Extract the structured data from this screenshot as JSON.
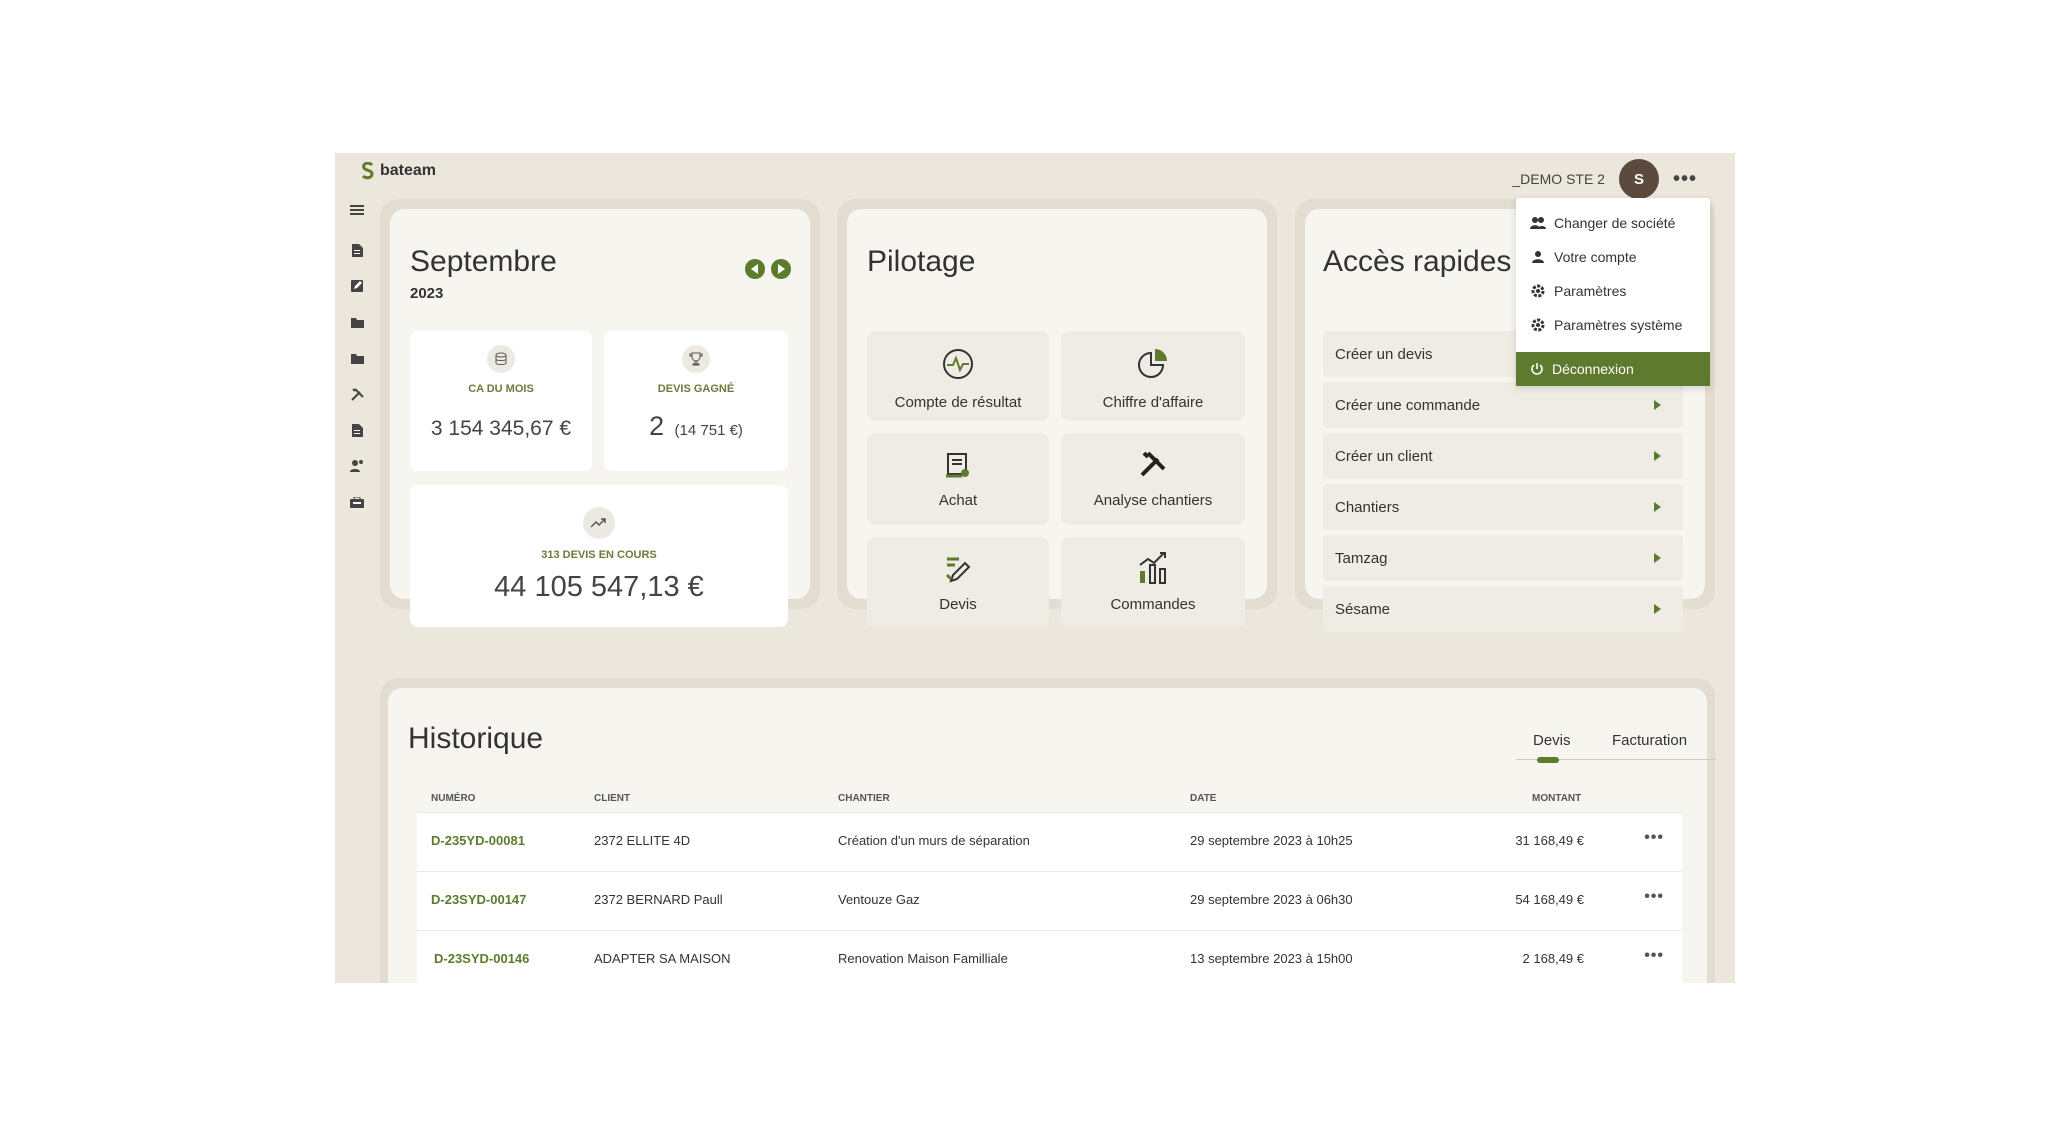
{
  "app": {
    "brand": "bateam",
    "company": "_DEMO STE 2",
    "avatar_initial": "S",
    "accent": "#5e7a2e"
  },
  "menu": {
    "items": [
      {
        "label": "Changer de société",
        "icon": "people-icon"
      },
      {
        "label": "Votre compte",
        "icon": "person-icon"
      },
      {
        "label": "Paramètres",
        "icon": "gear-icon"
      },
      {
        "label": "Paramètres système",
        "icon": "gear-icon"
      }
    ],
    "logout": "Déconnexion"
  },
  "sidebar": {
    "icons": [
      "menu-icon",
      "document-icon",
      "edit-document-icon",
      "folder-icon",
      "folder-icon",
      "tools-icon",
      "document-icon",
      "users-icon",
      "toolbox-icon"
    ]
  },
  "month": {
    "title": "Septembre",
    "year": "2023",
    "ca_label": "CA DU MOIS",
    "ca_value": "3 154 345,67 €",
    "devis_label": "DEVIS GAGNÉ",
    "devis_count": "2",
    "devis_amount": "(14 751 €)",
    "encours_label": "313 DEVIS EN COURS",
    "encours_value": "44 105 547,13 €"
  },
  "pilotage": {
    "title": "Pilotage",
    "tiles": [
      "Compte de résultat",
      "Chiffre d'affaire",
      "Achat",
      "Analyse chantiers",
      "Devis",
      "Commandes"
    ]
  },
  "quick": {
    "title": "Accès rapides",
    "items": [
      "Créer un devis",
      "Créer une commande",
      "Créer un client",
      "Chantiers",
      "Tamzag",
      "Sésame"
    ]
  },
  "history": {
    "title": "Historique",
    "tabs": [
      "Devis",
      "Facturation"
    ],
    "columns": [
      "NUMÉRO",
      "CLIENT",
      "CHANTIER",
      "DATE",
      "MONTANT"
    ],
    "rows": [
      {
        "numero": "D-235YD-00081",
        "client": "2372 ELLITE 4D",
        "chantier": "Création d'un murs de séparation",
        "date": "29 septembre 2023 à 10h25",
        "montant": "31 168,49 €"
      },
      {
        "numero": "D-23SYD-00147",
        "client": "2372 BERNARD Paull",
        "chantier": "Ventouze Gaz",
        "date": "29 septembre 2023 à  06h30",
        "montant": "54 168,49 €"
      },
      {
        "numero": "D-23SYD-00146",
        "client": "ADAPTER SA MAISON",
        "chantier": "Renovation Maison Familliale",
        "date": "13 septembre 2023 à 15h00",
        "montant": "2 168,49 €"
      }
    ]
  }
}
